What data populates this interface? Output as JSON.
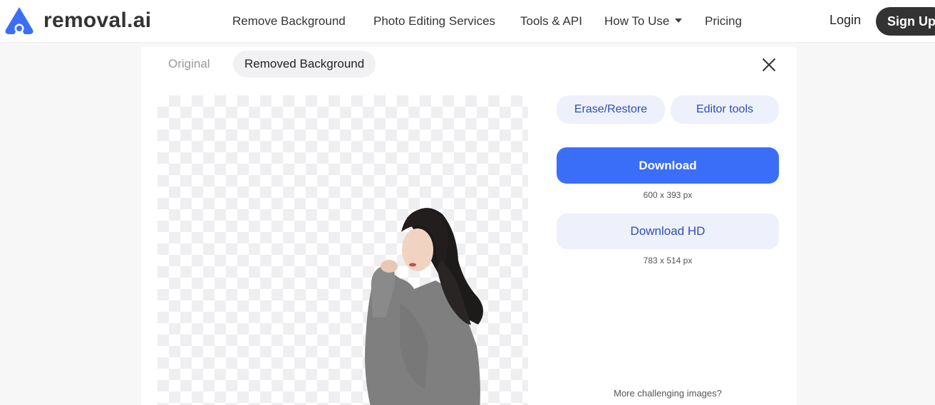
{
  "brand": {
    "name": "removal.ai",
    "accent": "#3b6ef8"
  },
  "nav": {
    "items": [
      "Remove Background",
      "Photo Editing Services",
      "Tools & API",
      "How To Use",
      "Pricing"
    ],
    "dropdown_icon": "caret-down-icon",
    "login": "Login",
    "signup": "Sign Up"
  },
  "result": {
    "tabs": {
      "original": "Original",
      "removed": "Removed Background"
    },
    "close_icon": "close-icon",
    "actions": {
      "erase_restore": "Erase/Restore",
      "editor_tools": "Editor tools"
    },
    "download": {
      "label": "Download",
      "size": "600 x 393 px"
    },
    "download_hd": {
      "label": "Download HD",
      "size": "783 x 514 px"
    },
    "more_link": "More challenging images?"
  }
}
